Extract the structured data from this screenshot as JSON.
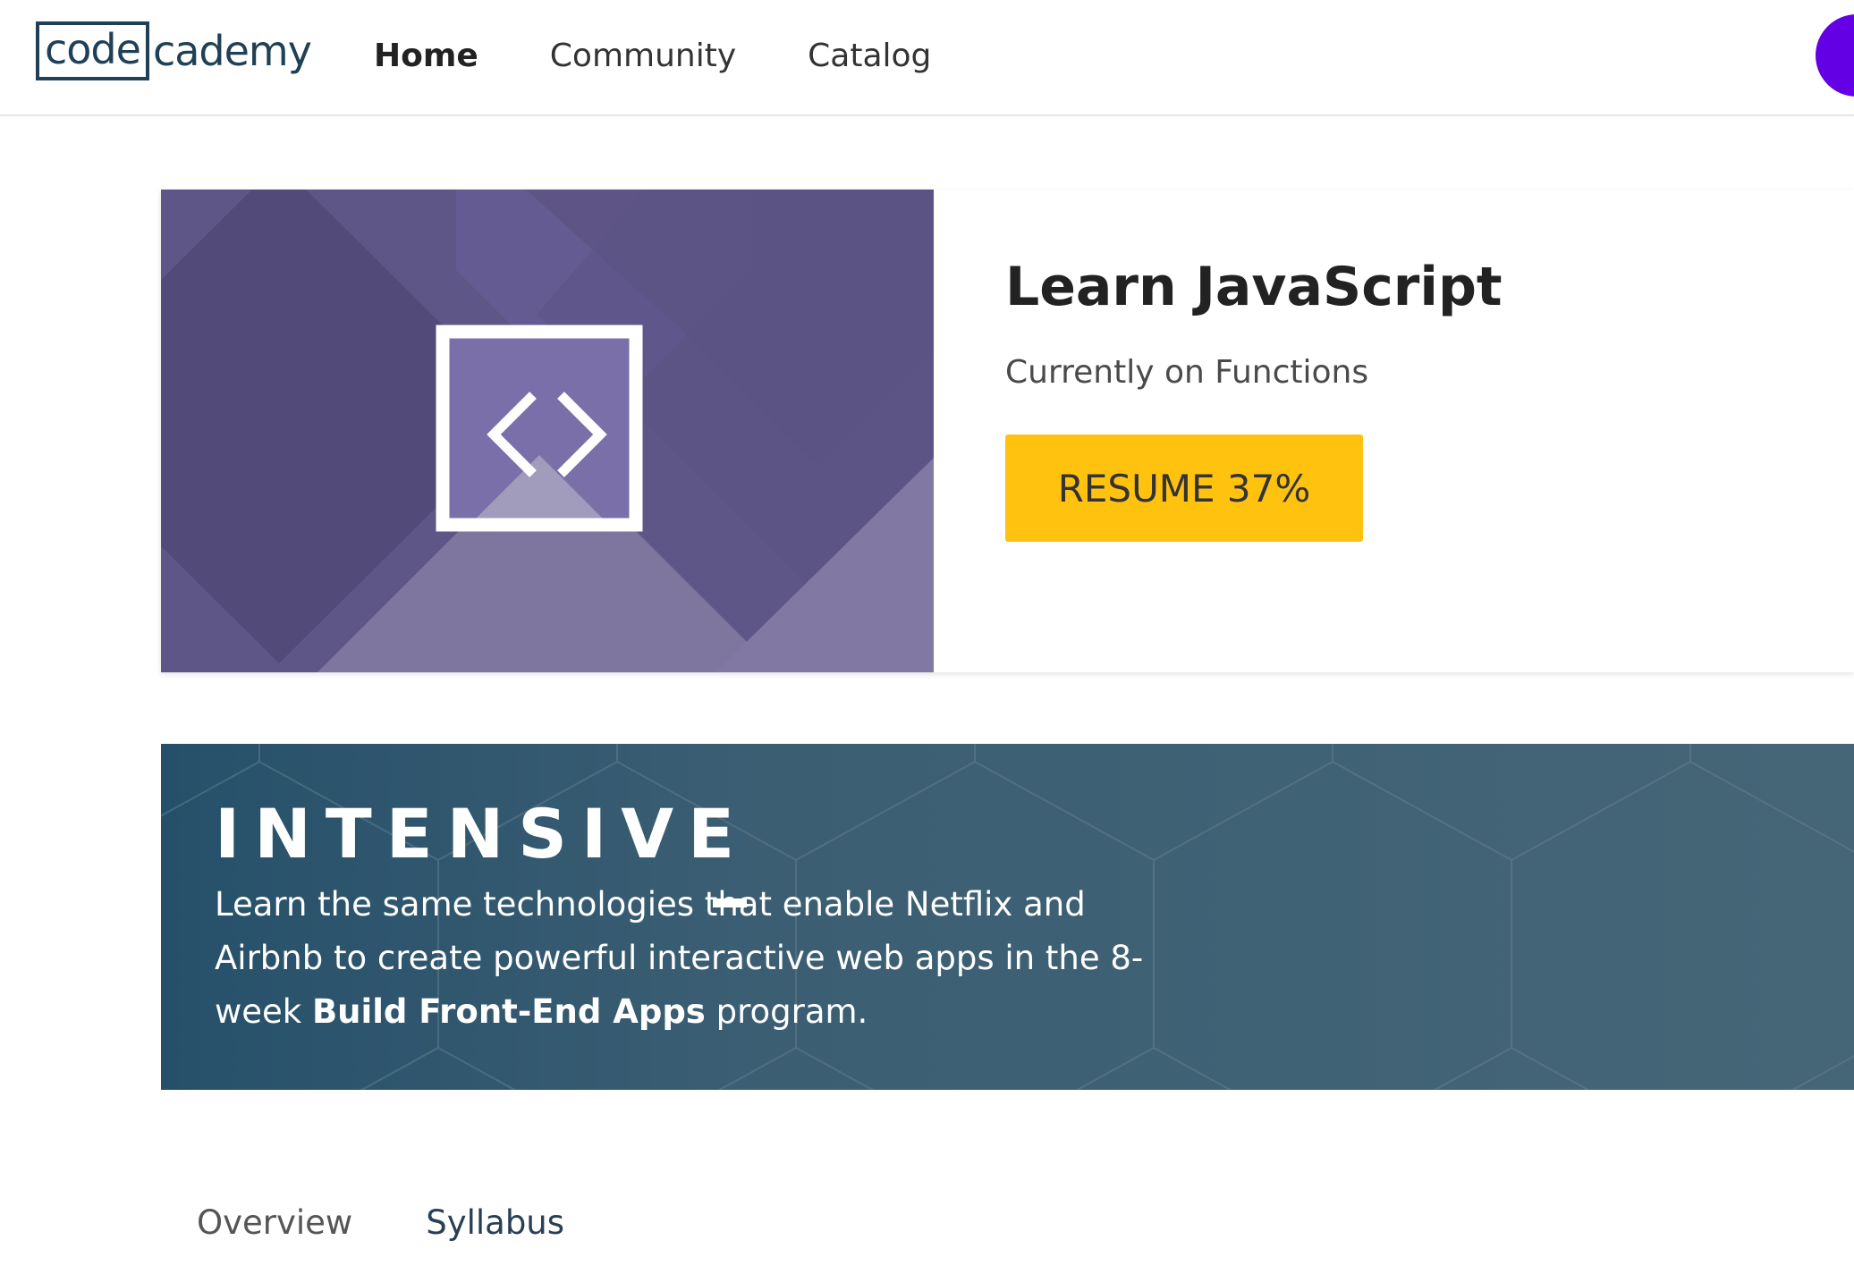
{
  "header": {
    "logo_left": "code",
    "logo_right": "cademy",
    "nav": [
      {
        "label": "Home",
        "active": true
      },
      {
        "label": "Community",
        "active": false
      },
      {
        "label": "Catalog",
        "active": false
      }
    ],
    "avatar_color": "#6400e4"
  },
  "course": {
    "title": "Learn JavaScript",
    "subtitle": "Currently on Functions",
    "resume_label": "RESUME 37%",
    "progress_percent": 37,
    "icon": "code-brackets-icon",
    "art_color": "#5f5688",
    "button_color": "#ffc20f"
  },
  "intensive": {
    "brand": "INTENSIVE",
    "text_before": "Learn the same technologies that enable Netflix and Airbnb to create powerful interactive web apps in the 8-week ",
    "text_bold": "Build Front-End Apps",
    "text_after": " program.",
    "background_color": "#3b5e73"
  },
  "tabs": [
    {
      "label": "Overview"
    },
    {
      "label": "Syllabus"
    }
  ]
}
